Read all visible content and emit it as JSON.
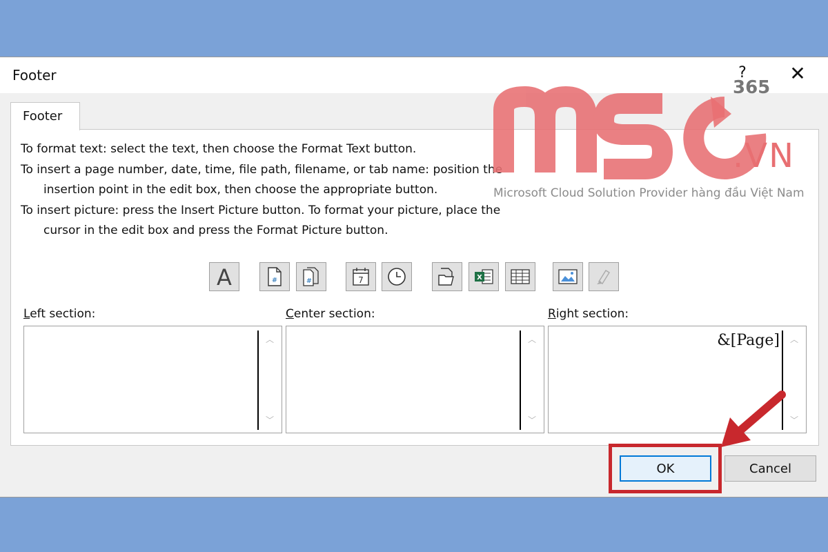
{
  "dialog": {
    "title": "Footer",
    "help": "?",
    "close": "✕",
    "tab_label": "Footer"
  },
  "instructions": {
    "line1": "To format text:  select the text, then choose the Format Text button.",
    "line2": "To insert a page number, date, time, file path, filename, or tab name:  position the",
    "line3": "insertion point in the edit box, then choose the appropriate button.",
    "line4": "To insert picture: press the Insert Picture button.  To format your picture, place the",
    "line5": "cursor in the edit box and press the Format Picture button."
  },
  "toolbar": [
    {
      "name": "format-text",
      "icon": "format-text-icon"
    },
    {
      "name": "insert-page-number",
      "icon": "page-number-icon"
    },
    {
      "name": "insert-number-of-pages",
      "icon": "number-of-pages-icon"
    },
    {
      "name": "insert-date",
      "icon": "calendar-icon"
    },
    {
      "name": "insert-time",
      "icon": "clock-icon"
    },
    {
      "name": "insert-file-path",
      "icon": "folder-icon"
    },
    {
      "name": "insert-file-name",
      "icon": "excel-file-icon"
    },
    {
      "name": "insert-sheet-name",
      "icon": "sheet-icon"
    },
    {
      "name": "insert-picture",
      "icon": "picture-icon"
    },
    {
      "name": "format-picture",
      "icon": "format-picture-icon"
    }
  ],
  "sections": {
    "left": {
      "label_key": "L",
      "label_rest": "eft section:",
      "value": ""
    },
    "center": {
      "label_key": "C",
      "label_rest": "enter section:",
      "value": ""
    },
    "right": {
      "label_key": "R",
      "label_rest": "ight section:",
      "value": "&[Page]"
    }
  },
  "buttons": {
    "ok": "OK",
    "cancel": "Cancel"
  },
  "watermark": {
    "brand_number": "365",
    "domain": ".VN",
    "tagline": "Microsoft Cloud Solution Provider hàng đầu Việt Nam"
  },
  "colors": {
    "background": "#7ba2d7",
    "highlight": "#c8282d",
    "watermark": "#e86f72",
    "ok_border": "#0078d7"
  }
}
